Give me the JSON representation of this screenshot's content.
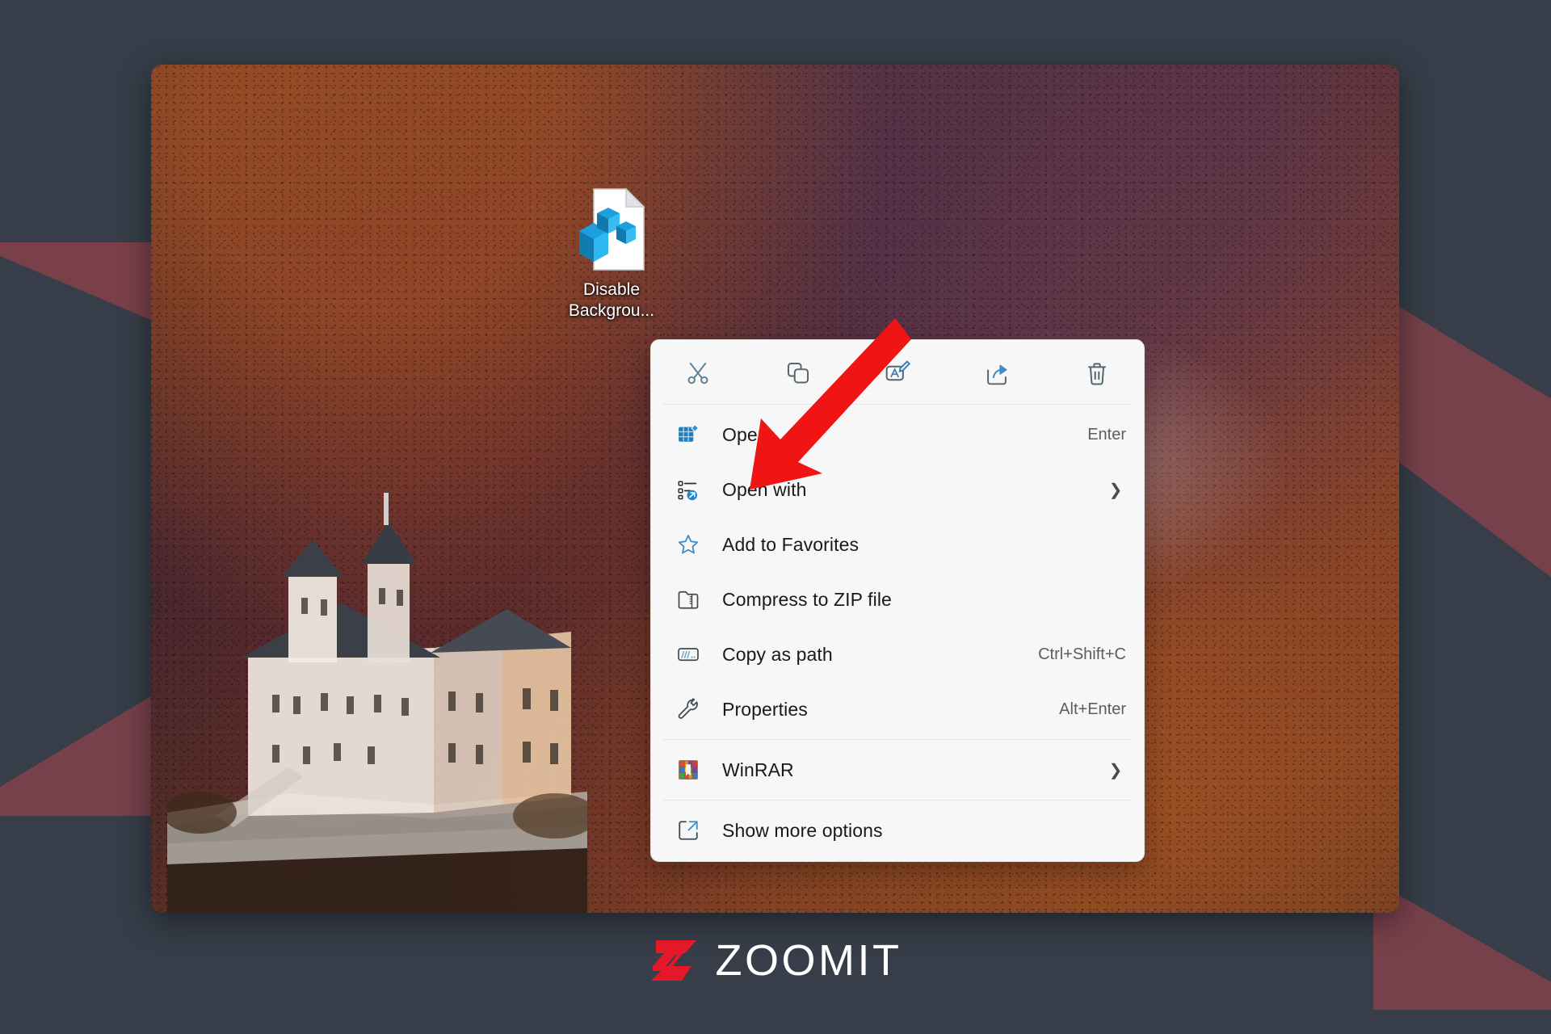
{
  "page": {
    "background_color": "#373e49",
    "accent_red": "#7a4049"
  },
  "desktop": {
    "icon": {
      "name": "registry-file-icon",
      "label_line1": "Disable",
      "label_line2": "Backgrou...",
      "label_full": "Disable Backgrou..."
    }
  },
  "context_menu": {
    "command_bar": [
      {
        "id": "cut",
        "icon": "scissors-icon",
        "tooltip": "Cut"
      },
      {
        "id": "copy",
        "icon": "copy-icon",
        "tooltip": "Copy"
      },
      {
        "id": "rename",
        "icon": "rename-icon",
        "tooltip": "Rename"
      },
      {
        "id": "share",
        "icon": "share-icon",
        "tooltip": "Share"
      },
      {
        "id": "delete",
        "icon": "trash-icon",
        "tooltip": "Delete"
      }
    ],
    "items": [
      {
        "id": "open",
        "label": "Open",
        "shortcut": "Enter",
        "submenu": false,
        "icon": "open-grid-icon"
      },
      {
        "id": "open-with",
        "label": "Open with",
        "shortcut": "",
        "submenu": true,
        "icon": "open-with-icon"
      },
      {
        "id": "favorites",
        "label": "Add to Favorites",
        "shortcut": "",
        "submenu": false,
        "icon": "star-icon"
      },
      {
        "id": "compress",
        "label": "Compress to ZIP file",
        "shortcut": "",
        "submenu": false,
        "icon": "zip-folder-icon"
      },
      {
        "id": "copy-path",
        "label": "Copy as path",
        "shortcut": "Ctrl+Shift+C",
        "submenu": false,
        "icon": "copy-path-icon"
      },
      {
        "id": "properties",
        "label": "Properties",
        "shortcut": "Alt+Enter",
        "submenu": false,
        "icon": "wrench-icon"
      }
    ],
    "winrar": {
      "id": "winrar",
      "label": "WinRAR",
      "shortcut": "",
      "submenu": true,
      "icon": "winrar-icon"
    },
    "show_more": {
      "id": "show-more",
      "label": "Show more options",
      "shortcut": "",
      "submenu": false,
      "icon": "expand-arrow-icon"
    }
  },
  "annotation": {
    "arrow": {
      "name": "red-arrow-pointer",
      "color": "#f01414",
      "points_to": "Open"
    }
  },
  "branding": {
    "wordmark": "ZOOMIT",
    "mark_color": "#e3182a",
    "word_color": "#ffffff"
  }
}
